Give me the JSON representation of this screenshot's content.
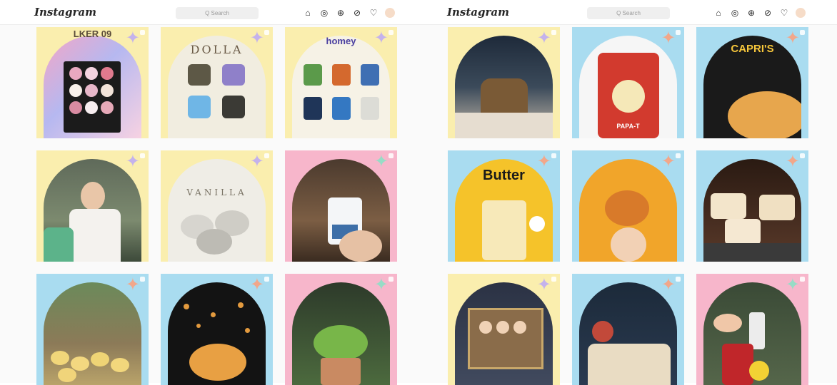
{
  "colors": {
    "yellow": "#faeeae",
    "blue": "#a9dcf0",
    "pink": "#f7b6cb",
    "lavender": "#c4b2ec",
    "peach": "#f2a78a",
    "mint": "#97dcc6"
  },
  "left": {
    "logo": "Instagram",
    "search_placeholder": "Q Search",
    "nav_icons": [
      "home-icon",
      "messenger-icon",
      "new-post-icon",
      "explore-icon",
      "heart-icon",
      "avatar"
    ],
    "posts": [
      {
        "bg": "yellow",
        "star": "lavender",
        "caption": "LKER 09"
      },
      {
        "bg": "yellow",
        "star": "lavender",
        "caption": "DOLLA"
      },
      {
        "bg": "yellow",
        "star": "lavender",
        "caption": "homey"
      },
      {
        "bg": "yellow",
        "star": "lavender",
        "caption": ""
      },
      {
        "bg": "yellow",
        "star": "lavender",
        "caption": "VANILLA"
      },
      {
        "bg": "pink",
        "star": "mint",
        "caption": ""
      },
      {
        "bg": "blue",
        "star": "peach",
        "caption": ""
      },
      {
        "bg": "blue",
        "star": "peach",
        "caption": ""
      },
      {
        "bg": "pink",
        "star": "mint",
        "caption": ""
      }
    ]
  },
  "right": {
    "logo": "Instagram",
    "search_placeholder": "Q Search",
    "nav_icons": [
      "home-icon",
      "messenger-icon",
      "new-post-icon",
      "explore-icon",
      "heart-icon",
      "avatar"
    ],
    "posts": [
      {
        "bg": "yellow",
        "star": "lavender",
        "caption": ""
      },
      {
        "bg": "blue",
        "star": "peach",
        "caption": "PAPA-T"
      },
      {
        "bg": "blue",
        "star": "peach",
        "caption": "CAPRI'S"
      },
      {
        "bg": "blue",
        "star": "peach",
        "caption": "Butter"
      },
      {
        "bg": "blue",
        "star": "peach",
        "caption": ""
      },
      {
        "bg": "blue",
        "star": "peach",
        "caption": ""
      },
      {
        "bg": "yellow",
        "star": "lavender",
        "caption": ""
      },
      {
        "bg": "blue",
        "star": "peach",
        "caption": ""
      },
      {
        "bg": "pink",
        "star": "mint",
        "caption": ""
      }
    ]
  }
}
